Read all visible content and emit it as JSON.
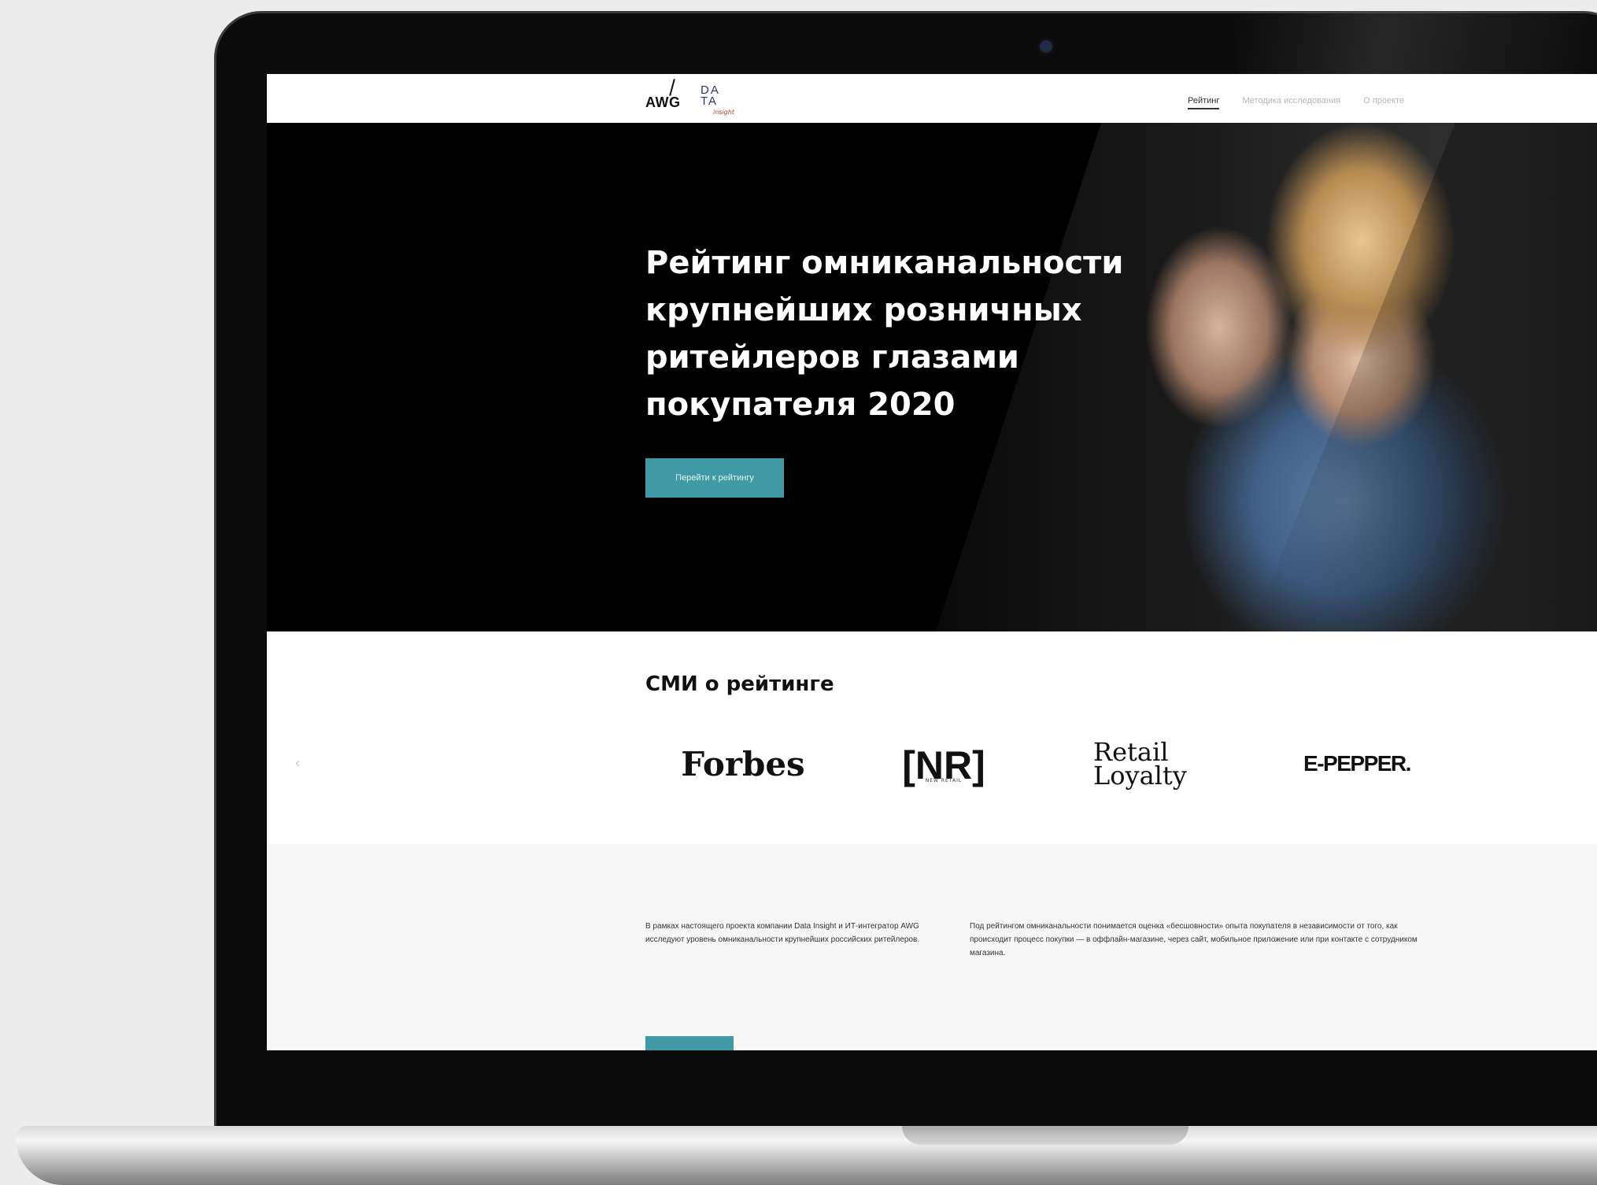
{
  "nav": {
    "logo": {
      "brand": "AWG",
      "data_top": "DA",
      "data_bottom": "TA",
      "sub": "insight"
    },
    "items": [
      {
        "label": "Рейтинг",
        "active": true
      },
      {
        "label": "Методика исследования",
        "active": false
      },
      {
        "label": "О проекте",
        "active": false
      }
    ]
  },
  "hero": {
    "title": "Рейтинг омниканальности крупнейших розничных ритейлеров глазами покупателя 2020",
    "button_label": "Перейти к рейтингу"
  },
  "media": {
    "title": "СМИ о рейтинге",
    "prev_arrow": "‹",
    "logos": {
      "forbes": "Forbes",
      "nr": "[NR]",
      "nr_sub": "NEW RETAIL",
      "retail_line1": "Retail",
      "retail_line2": "Loyalty",
      "epepper": "E-PEPPER."
    }
  },
  "about": {
    "left_text": "В рамках настоящего проекта компании Data Insight и ИТ-интегратор AWG исследуют уровень омниканальности крупнейших российских ритейлеров.",
    "right_text": "Под рейтингом омниканальности понимается оценка «бесшовности» опыта покупателя в независимости от того, как происходит процесс покупки — в оффлайн-магазине, через сайт, мобильное приложение или при контакте с сотрудником магазина."
  },
  "colors": {
    "accent": "#3f9aa6",
    "hero_bg": "#000000",
    "page_bg": "#ffffff"
  }
}
